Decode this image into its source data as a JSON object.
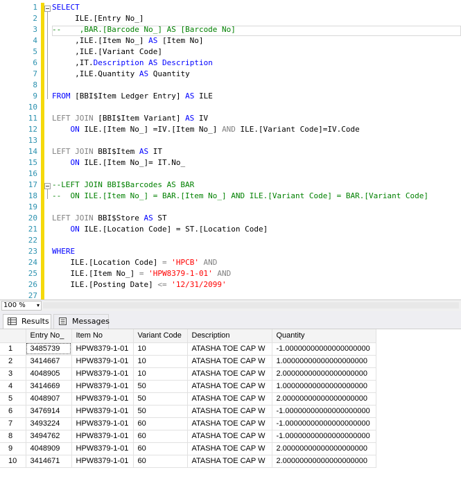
{
  "editor": {
    "line_numbers": [
      "1",
      "2",
      "3",
      "4",
      "5",
      "6",
      "7",
      "8",
      "9",
      "10",
      "11",
      "12",
      "13",
      "14",
      "15",
      "16",
      "17",
      "18",
      "19",
      "20",
      "21",
      "22",
      "23",
      "24",
      "25",
      "26",
      "27"
    ],
    "tokens": {
      "select": "SELECT",
      "l2": "     ILE.[Entry No_]",
      "l3_dash": "--",
      "l3_a": "    ,BAR.[Barcode No_] ",
      "l3_as": "AS",
      "l3_b": " [Barcode No]",
      "l4_a": "     ,ILE.[Item No_] ",
      "l4_as": "AS",
      "l4_b": " [Item No]",
      "l5": "     ,ILE.[Variant Code]",
      "l6_a": "     ,IT.",
      "l6_desc1": "Description",
      "l6_as": " AS ",
      "l6_desc2": "Description",
      "l7_a": "     ,ILE.",
      "l7_q": "Quantity",
      "l7_as": " AS ",
      "l7_b": "Quantity",
      "from": "FROM",
      "l9_b": " [BBI$Item Ledger Entry] ",
      "l9_as": "AS",
      "l9_c": " ILE",
      "leftjoin1": "LEFT JOIN",
      "l11_b": " [BBI$Item Variant] ",
      "l11_as": "AS",
      "l11_c": " IV",
      "on1": "    ON",
      "l12_b": " ILE.[Item No_] =IV.[Item No_] ",
      "and1": "AND",
      "l12_c": " ILE.[Variant Code]=IV.Code",
      "leftjoin2": "LEFT JOIN",
      "l14_b": " BBI$Item ",
      "l14_as": "AS",
      "l14_c": " IT",
      "on2": "    ON",
      "l15_b": " ILE.[Item No_]= IT.No_",
      "l17": "--LEFT JOIN BBI$Barcodes AS BAR",
      "l18": "--  ON ILE.[Item No_] = BAR.[Item No_] AND ILE.[Variant Code] = BAR.[Variant Code]",
      "leftjoin3": "LEFT JOIN",
      "l20_b": " BBI$Store ",
      "l20_as": "AS",
      "l20_c": " ST",
      "on3": "    ON",
      "l21_b": " ILE.[Location Code] = ST.[Location Code]",
      "where": "WHERE",
      "l24_a": "    ILE.[Location Code] ",
      "l24_eq": "=",
      "l24_s": " 'HPCB'",
      "l24_and": " AND",
      "l25_a": "    ILE.[Item No_] ",
      "l25_eq": "=",
      "l25_s": " 'HPW8379-1-01'",
      "l25_and": " AND",
      "l26_a": "    ILE.[Posting Date] ",
      "l26_le": "<=",
      "l26_s": " '12/31/2099'"
    }
  },
  "zoom": {
    "value": "100 %",
    "arrow": "▾"
  },
  "tabs": {
    "results": "Results",
    "messages": "Messages"
  },
  "grid": {
    "columns": [
      "Entry No_",
      "Item No",
      "Variant Code",
      "Description",
      "Quantity"
    ],
    "rows": [
      [
        "1",
        "3485739",
        "HPW8379-1-01",
        "10",
        "ATASHA TOE CAP W",
        "-1.00000000000000000000"
      ],
      [
        "2",
        "3414667",
        "HPW8379-1-01",
        "10",
        "ATASHA TOE CAP W",
        "1.00000000000000000000"
      ],
      [
        "3",
        "4048905",
        "HPW8379-1-01",
        "10",
        "ATASHA TOE CAP W",
        "2.00000000000000000000"
      ],
      [
        "4",
        "3414669",
        "HPW8379-1-01",
        "50",
        "ATASHA TOE CAP W",
        "1.00000000000000000000"
      ],
      [
        "5",
        "4048907",
        "HPW8379-1-01",
        "50",
        "ATASHA TOE CAP W",
        "2.00000000000000000000"
      ],
      [
        "6",
        "3476914",
        "HPW8379-1-01",
        "50",
        "ATASHA TOE CAP W",
        "-1.00000000000000000000"
      ],
      [
        "7",
        "3493224",
        "HPW8379-1-01",
        "60",
        "ATASHA TOE CAP W",
        "-1.00000000000000000000"
      ],
      [
        "8",
        "3494762",
        "HPW8379-1-01",
        "60",
        "ATASHA TOE CAP W",
        "-1.00000000000000000000"
      ],
      [
        "9",
        "4048909",
        "HPW8379-1-01",
        "60",
        "ATASHA TOE CAP W",
        "2.00000000000000000000"
      ],
      [
        "10",
        "3414671",
        "HPW8379-1-01",
        "60",
        "ATASHA TOE CAP W",
        "2.00000000000000000000"
      ]
    ]
  }
}
